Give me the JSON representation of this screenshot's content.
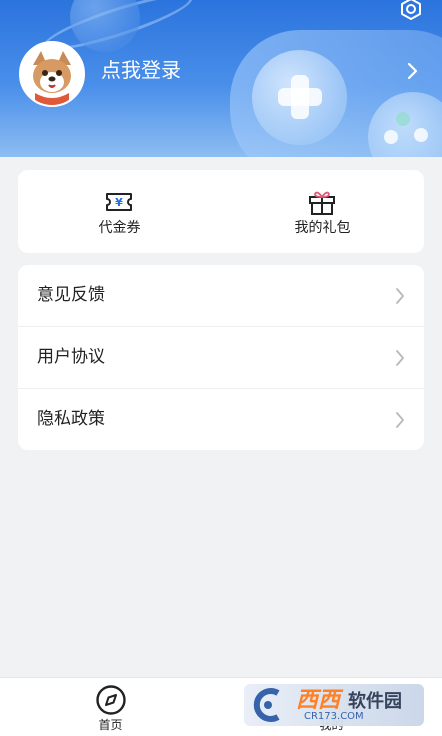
{
  "header": {
    "login_label": "点我登录",
    "avatar_icon": "dog-avatar-icon",
    "settings_icon": "gear-icon",
    "arrow_icon": "chevron-right-icon"
  },
  "quick_actions": [
    {
      "label": "代金券",
      "icon": "voucher-ticket-icon"
    },
    {
      "label": "我的礼包",
      "icon": "gift-icon"
    }
  ],
  "menu": {
    "items": [
      {
        "label": "意见反馈"
      },
      {
        "label": "用户协议"
      },
      {
        "label": "隐私政策"
      }
    ]
  },
  "tabbar": {
    "items": [
      {
        "label": "首页",
        "icon": "compass-icon"
      },
      {
        "label": "我的"
      }
    ]
  },
  "watermark": {
    "brand": "西西",
    "name": "软件园",
    "url": "CR173.COM"
  },
  "colors": {
    "header_top": "#2b74dd",
    "header_bottom": "#8dbdf2",
    "page_bg": "#f1f2f4",
    "accent_blue": "#1f6fe0",
    "gift_pink": "#e05a7a"
  }
}
